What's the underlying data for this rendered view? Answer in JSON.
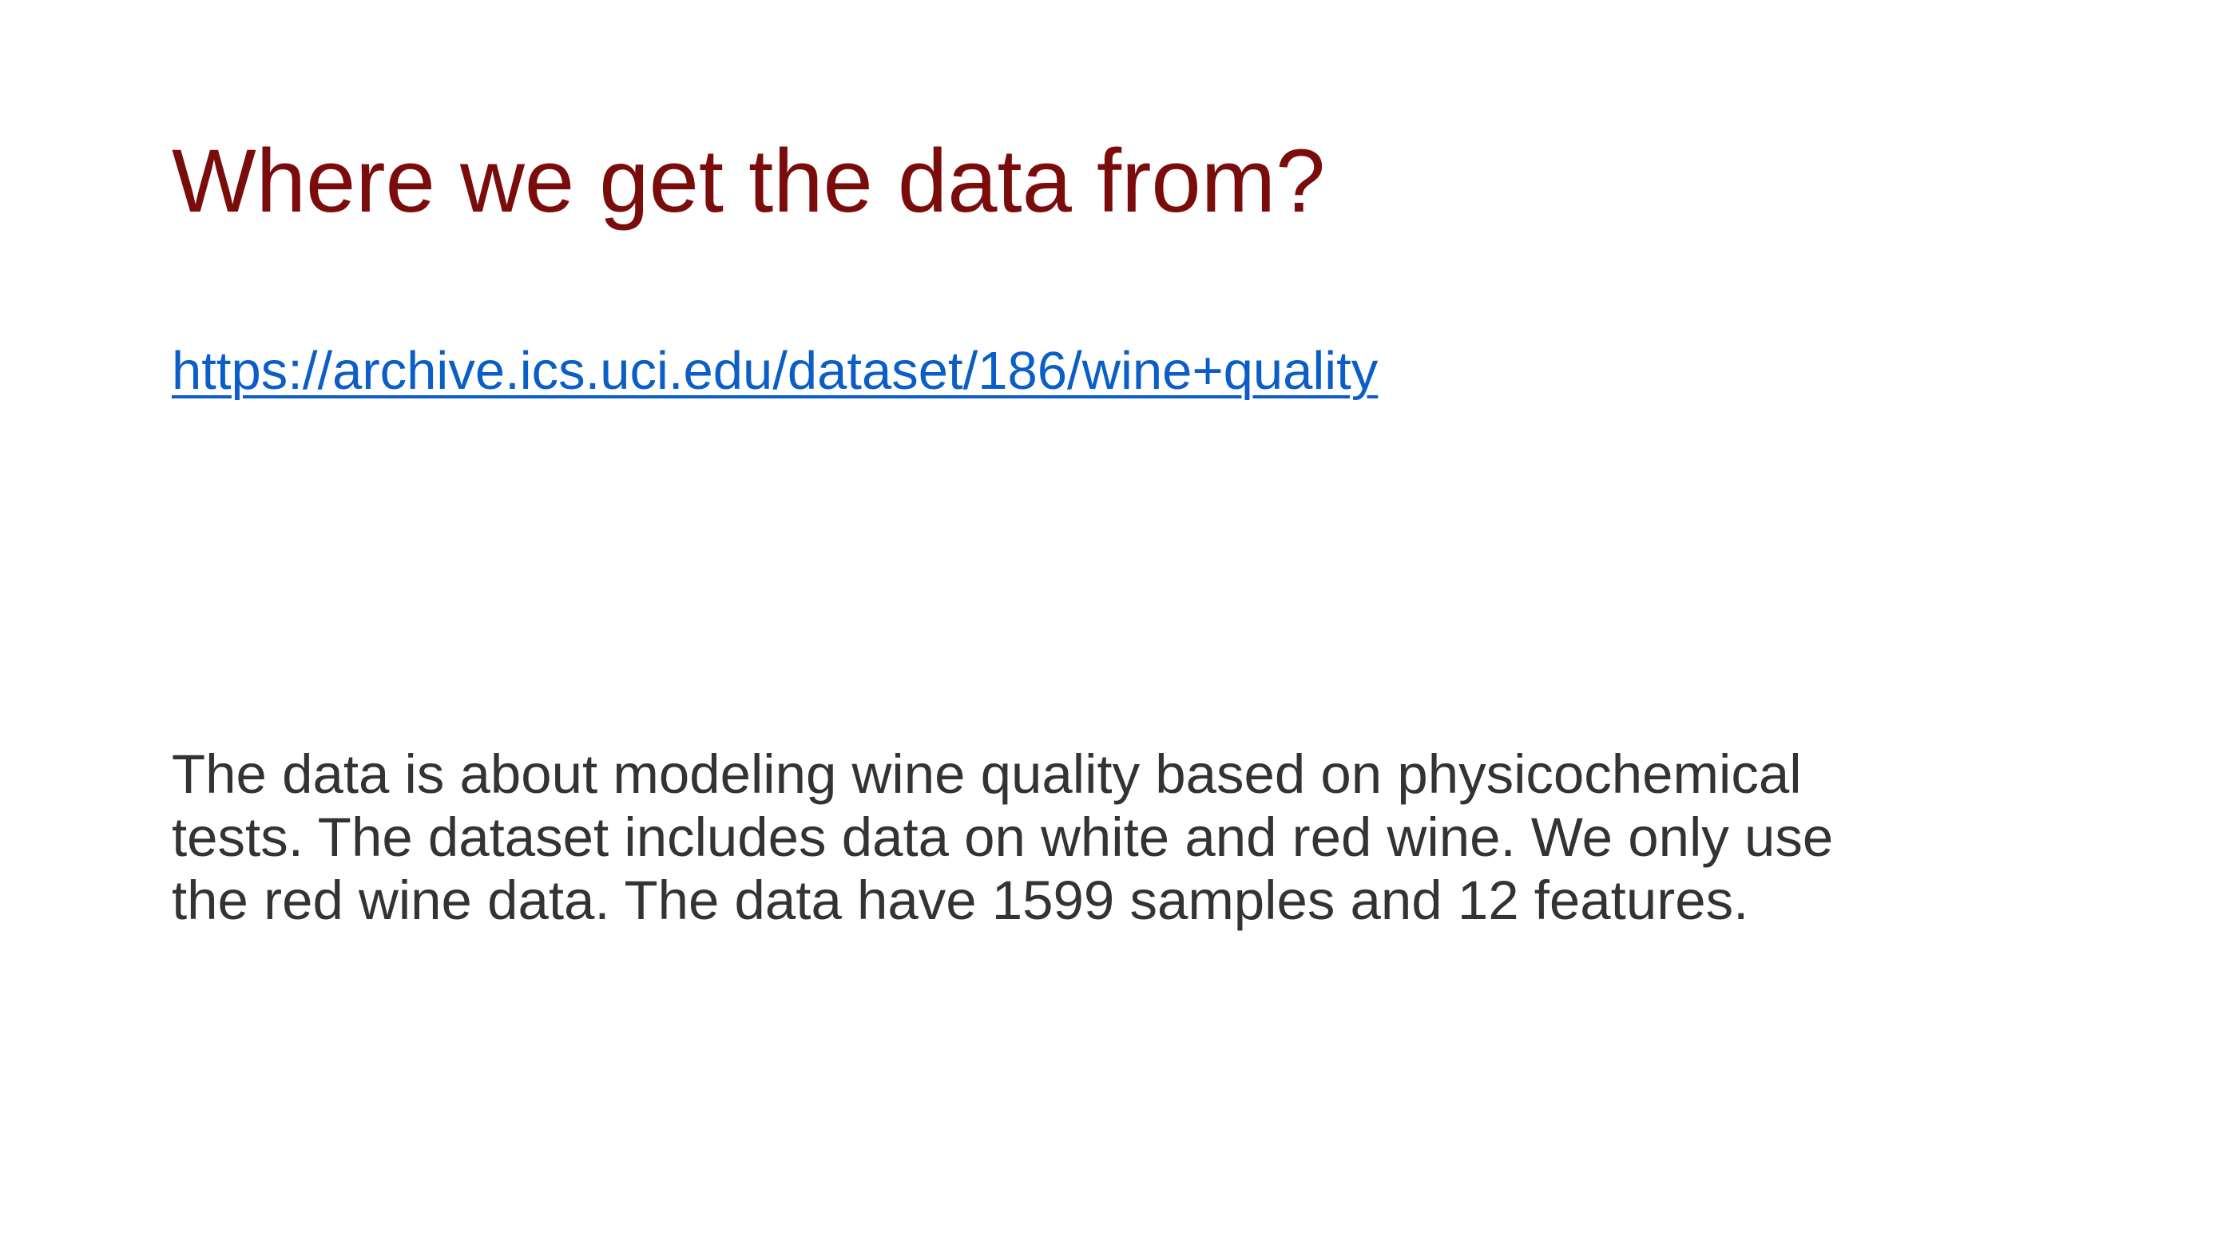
{
  "slide": {
    "title": "Where we get the data from?",
    "link": {
      "text": "https://archive.ics.uci.edu/dataset/186/wine+quality"
    },
    "description_lines": [
      "The data is about modeling wine quality based on physicochemical",
      "tests. The dataset includes data on white and red wine. We only use",
      "the red wine data. The data have 1599 samples and 12 features."
    ]
  },
  "colors": {
    "title": "#7b0c0c",
    "link": "#0b5ec7",
    "body_text": "#333333",
    "background": "#ffffff"
  }
}
